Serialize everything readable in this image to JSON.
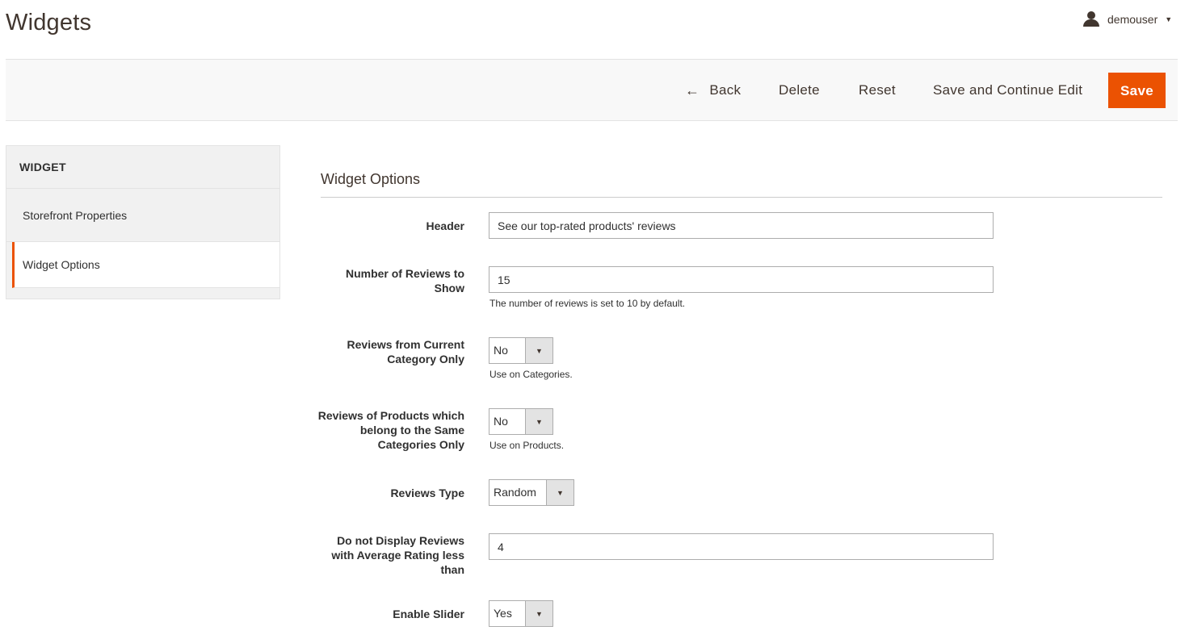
{
  "header": {
    "title": "Widgets",
    "username": "demouser"
  },
  "toolbar": {
    "back_label": "Back",
    "delete_label": "Delete",
    "reset_label": "Reset",
    "save_continue_label": "Save and Continue Edit",
    "save_label": "Save",
    "accent_color": "#eb5202"
  },
  "sidebar": {
    "title": "WIDGET",
    "items": [
      {
        "label": "Storefront Properties",
        "active": false
      },
      {
        "label": "Widget Options",
        "active": true
      }
    ]
  },
  "form": {
    "section_title": "Widget Options",
    "header": {
      "label": "Header",
      "value": "See our top-rated products' reviews"
    },
    "num_reviews": {
      "label": "Number of Reviews to Show",
      "value": "15",
      "note": "The number of reviews is set to 10 by default."
    },
    "current_category": {
      "label": "Reviews from Current Category Only",
      "value": "No",
      "note": "Use on Categories."
    },
    "same_categories": {
      "label": "Reviews of Products which belong to the Same Categories Only",
      "value": "No",
      "note": "Use on Products."
    },
    "reviews_type": {
      "label": "Reviews Type",
      "value": "Random"
    },
    "min_rating": {
      "label": "Do not Display Reviews with Average Rating less than",
      "value": "4"
    },
    "enable_slider": {
      "label": "Enable Slider",
      "value": "Yes"
    }
  }
}
